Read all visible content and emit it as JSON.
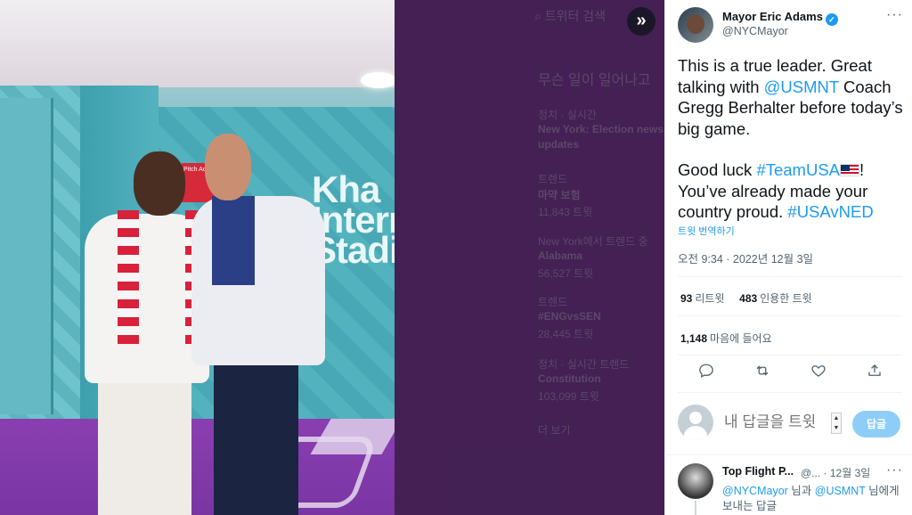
{
  "background": {
    "search_placeholder": "트위터 검색",
    "trends_title": "무슨 일이 일어나고",
    "trends": [
      {
        "meta": "정치 · 실시간",
        "label": "New York: Election news"
      },
      {
        "meta": "",
        "label": "updates"
      },
      {
        "meta": "트렌드",
        "label": "마약 보험"
      },
      {
        "meta": "11,843 트윗",
        "label": ""
      },
      {
        "meta": "New York에서 트렌드 중",
        "label": "Alabama"
      },
      {
        "meta": "56,527 트윗",
        "label": ""
      },
      {
        "meta": "트렌드",
        "label": "#ENGvsSEN"
      },
      {
        "meta": "28,445 트윗",
        "label": ""
      },
      {
        "meta": "정치 · 실시간 트렌드",
        "label": "Constitution"
      },
      {
        "meta": "103,099 트윗",
        "label": ""
      }
    ],
    "more_label": "더 보기"
  },
  "photo": {
    "wall_text": "Kha\nInterna\nStadi",
    "sign_text": "Pitch Access"
  },
  "expand_button": {
    "icon": "chevrons-right-icon",
    "glyph": "»"
  },
  "tweet": {
    "author_name": "Mayor Eric Adams",
    "author_handle": "@NYCMayor",
    "more_glyph": "···",
    "text": {
      "p1_a": "This is a true leader. Great talking with ",
      "p1_mention": "@USMNT",
      "p1_b": " Coach Gregg Berhalter before today’s big game.",
      "p2_a": "Good luck ",
      "p2_tag1": "#TeamUSA",
      "p2_b": "! You’ve already made your country proud. ",
      "p2_tag2": "#USAvNED"
    },
    "translate_label": "트윗 번역하기",
    "timestamp": "오전 9:34 · 2022년 12월 3일",
    "retweets_count": "93",
    "retweets_label": "리트윗",
    "quotes_count": "483",
    "quotes_label": "인용한 트윗",
    "likes_count": "1,148",
    "likes_label": "마음에 들어요",
    "actions": {
      "reply_icon": "reply-icon",
      "retweet_icon": "retweet-icon",
      "like_icon": "heart-icon",
      "share_icon": "share-icon"
    }
  },
  "reply_box": {
    "placeholder": "내 답글을 트윗",
    "button_label": "답글"
  },
  "reply": {
    "author_name": "Top Flight P...",
    "meta": "@... · 12월 3일",
    "more_glyph": "···",
    "line1_mention1": "@NYCMayor",
    "line1_mid": " 님과 ",
    "line1_mention2": "@USMNT",
    "line1_end": " 님에게",
    "line2": "보내는 답글"
  },
  "colors": {
    "accent": "#1d9bf0",
    "text_primary": "#0f1419",
    "text_secondary": "#536471",
    "overlay": "#461e5a"
  }
}
